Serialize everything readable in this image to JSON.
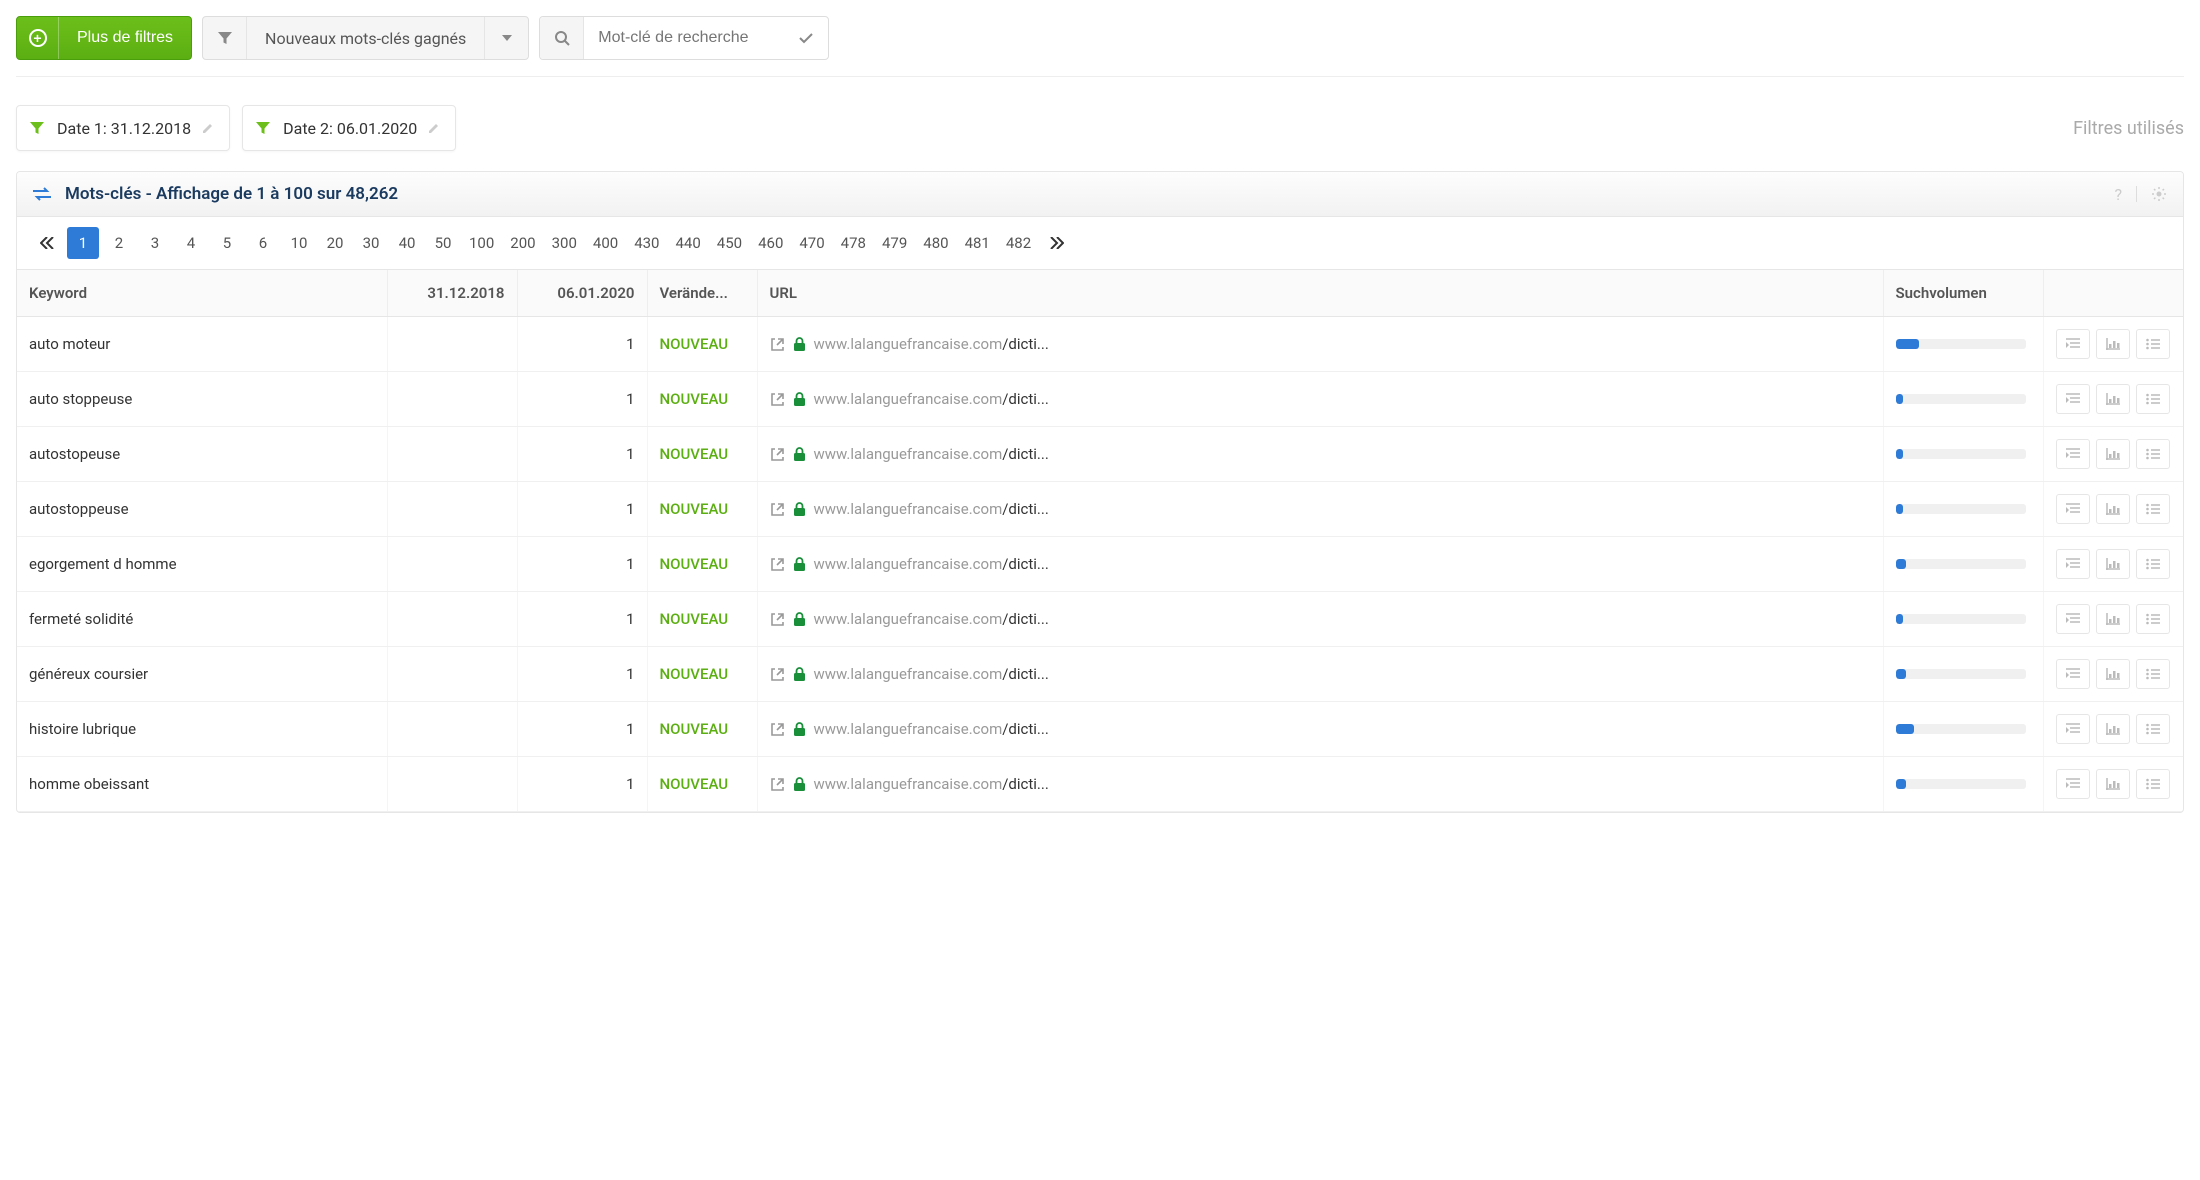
{
  "toolbar": {
    "more_filters": "Plus de filtres",
    "dropdown_label": "Nouveaux mots-clés gagnés",
    "search_placeholder": "Mot-clé de recherche"
  },
  "filters": {
    "date1_label": "Date 1: 31.12.2018",
    "date2_label": "Date 2: 06.01.2020",
    "used_label": "Filtres utilisés"
  },
  "panel": {
    "title": "Mots-clés - Affichage de 1 à 100 sur 48,262"
  },
  "pagination": [
    "1",
    "2",
    "3",
    "4",
    "5",
    "6",
    "10",
    "20",
    "30",
    "40",
    "50",
    "100",
    "200",
    "300",
    "400",
    "430",
    "440",
    "450",
    "460",
    "470",
    "478",
    "479",
    "480",
    "481",
    "482"
  ],
  "columns": {
    "keyword": "Keyword",
    "date1": "31.12.2018",
    "date2": "06.01.2020",
    "change": "Verände...",
    "url": "URL",
    "volume": "Suchvolumen"
  },
  "change_label": "NOUVEAU",
  "url_parts": {
    "domain": "www.lalanguefrancaise.com",
    "path": "/dicti..."
  },
  "rows": [
    {
      "kw": "auto moteur",
      "d2": "1",
      "vol": 18
    },
    {
      "kw": "auto stoppeuse",
      "d2": "1",
      "vol": 6
    },
    {
      "kw": "autostopeuse",
      "d2": "1",
      "vol": 6
    },
    {
      "kw": "autostoppeuse",
      "d2": "1",
      "vol": 6
    },
    {
      "kw": "egorgement d homme",
      "d2": "1",
      "vol": 8
    },
    {
      "kw": "fermeté solidité",
      "d2": "1",
      "vol": 6
    },
    {
      "kw": "généreux coursier",
      "d2": "1",
      "vol": 8
    },
    {
      "kw": "histoire lubrique",
      "d2": "1",
      "vol": 14
    },
    {
      "kw": "homme obeissant",
      "d2": "1",
      "vol": 8
    }
  ]
}
